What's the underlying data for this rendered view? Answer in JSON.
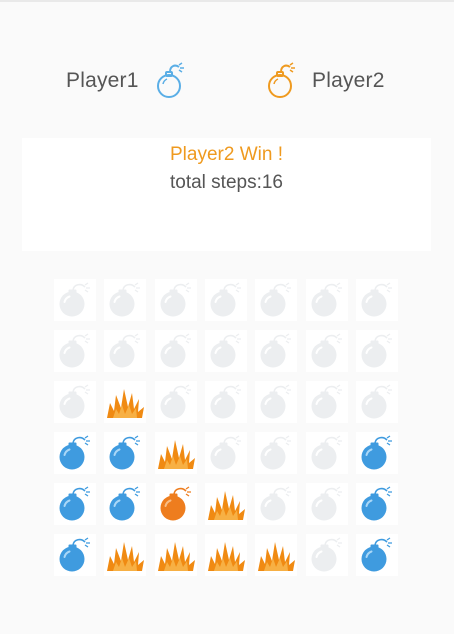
{
  "players": {
    "player1": {
      "name": "Player1",
      "icon": "blue-bomb-outline-icon",
      "color": "#5aaee6"
    },
    "player2": {
      "name": "Player2",
      "icon": "orange-bomb-outline-icon",
      "color": "#ef9a1f"
    }
  },
  "result": {
    "message": "Player2 Win !",
    "steps": "total steps:16"
  },
  "board": {
    "rows": 6,
    "cols": 7,
    "cells": [
      [
        "empty",
        "empty",
        "empty",
        "empty",
        "empty",
        "empty",
        "empty"
      ],
      [
        "empty",
        "empty",
        "empty",
        "empty",
        "empty",
        "empty",
        "empty"
      ],
      [
        "empty",
        "explosion",
        "empty",
        "empty",
        "empty",
        "empty",
        "empty"
      ],
      [
        "blue",
        "blue",
        "explosion",
        "empty",
        "empty",
        "empty",
        "blue"
      ],
      [
        "blue",
        "blue",
        "orange",
        "explosion",
        "empty",
        "empty",
        "blue"
      ],
      [
        "blue",
        "explosion",
        "explosion",
        "explosion",
        "explosion",
        "empty",
        "blue"
      ]
    ]
  },
  "colors": {
    "background": "#fafafa",
    "empty_bomb": "#eceef0",
    "blue_bomb": "#3f9bdf",
    "orange_bomb": "#ee7d1e",
    "explosion": "#f08a12"
  }
}
